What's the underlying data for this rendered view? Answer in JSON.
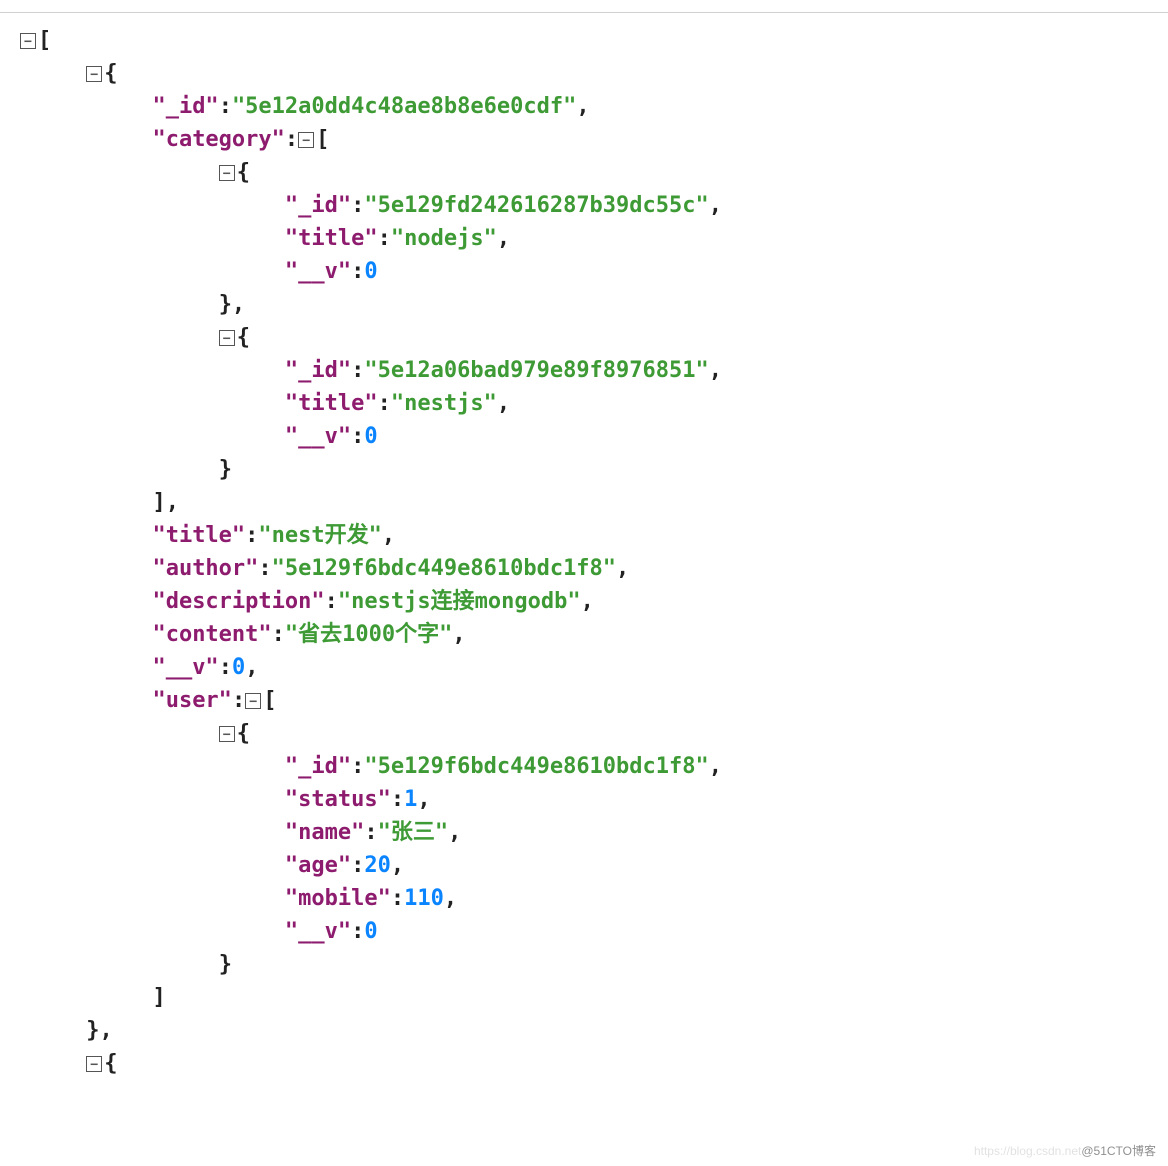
{
  "root": {
    "_id": "5e12a0dd4c48ae8b8e6e0cdf",
    "category": [
      {
        "_id": "5e129fd242616287b39dc55c",
        "title": "nodejs",
        "__v": 0
      },
      {
        "_id": "5e12a06bad979e89f8976851",
        "title": "nestjs",
        "__v": 0
      }
    ],
    "title": "nest开发",
    "author": "5e129f6bdc449e8610bdc1f8",
    "description": "nestjs连接mongodb",
    "content": "省去1000个字",
    "__v": 0,
    "user": [
      {
        "_id": "5e129f6bdc449e8610bdc1f8",
        "status": 1,
        "name": "张三",
        "age": 20,
        "mobile": 110,
        "__v": 0
      }
    ]
  },
  "keys": {
    "_id": "\"_id\"",
    "category": "\"category\"",
    "title": "\"title\"",
    "__v": "\"__v\"",
    "author": "\"author\"",
    "description": "\"description\"",
    "content": "\"content\"",
    "user": "\"user\"",
    "status": "\"status\"",
    "name": "\"name\"",
    "age": "\"age\"",
    "mobile": "\"mobile\""
  },
  "vals": {
    "root_id": "\"5e12a0dd4c48ae8b8e6e0cdf\"",
    "cat0_id": "\"5e129fd242616287b39dc55c\"",
    "cat0_title": "\"nodejs\"",
    "cat0_v": "0",
    "cat1_id": "\"5e12a06bad979e89f8976851\"",
    "cat1_title": "\"nestjs\"",
    "cat1_v": "0",
    "root_title": "\"nest开发\"",
    "root_author": "\"5e129f6bdc449e8610bdc1f8\"",
    "root_desc": "\"nestjs连接mongodb\"",
    "root_content": "\"省去1000个字\"",
    "root_v": "0",
    "user0_id": "\"5e129f6bdc449e8610bdc1f8\"",
    "user0_status": "1",
    "user0_name": "\"张三\"",
    "user0_age": "20",
    "user0_mobile": "110",
    "user0_v": "0"
  },
  "watermark": {
    "left": "https://blog.csdn.net",
    "right": "@51CTO博客"
  }
}
